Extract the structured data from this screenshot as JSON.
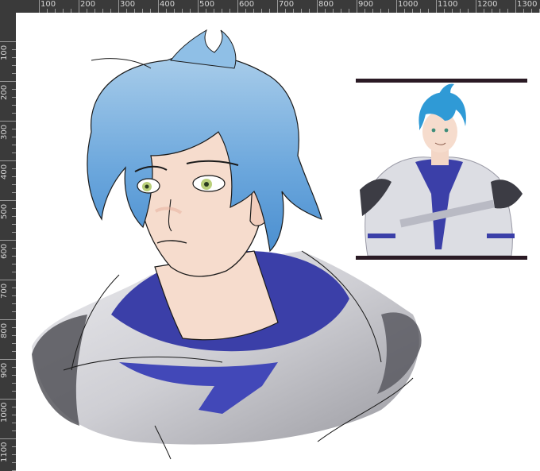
{
  "rulers": {
    "horizontal": [
      "100",
      "200",
      "300",
      "400",
      "500",
      "600",
      "700",
      "800",
      "900",
      "1000",
      "1100",
      "1200",
      "1300"
    ],
    "vertical": [
      "100",
      "200",
      "300",
      "400",
      "500",
      "600",
      "700",
      "800",
      "900",
      "1000",
      "1100"
    ]
  },
  "colors": {
    "ruler_background": "#3a3a3a",
    "canvas_background": "#ffffff",
    "hair_blue": "#7db4e0",
    "hood_indigo": "#3b3fa8",
    "skin": "#f6dccd",
    "ref_frame": "#2a1a24"
  },
  "artwork": {
    "main_sketch": "blue-haired-character-sketch",
    "reference_image": "character-reference-illustration"
  }
}
